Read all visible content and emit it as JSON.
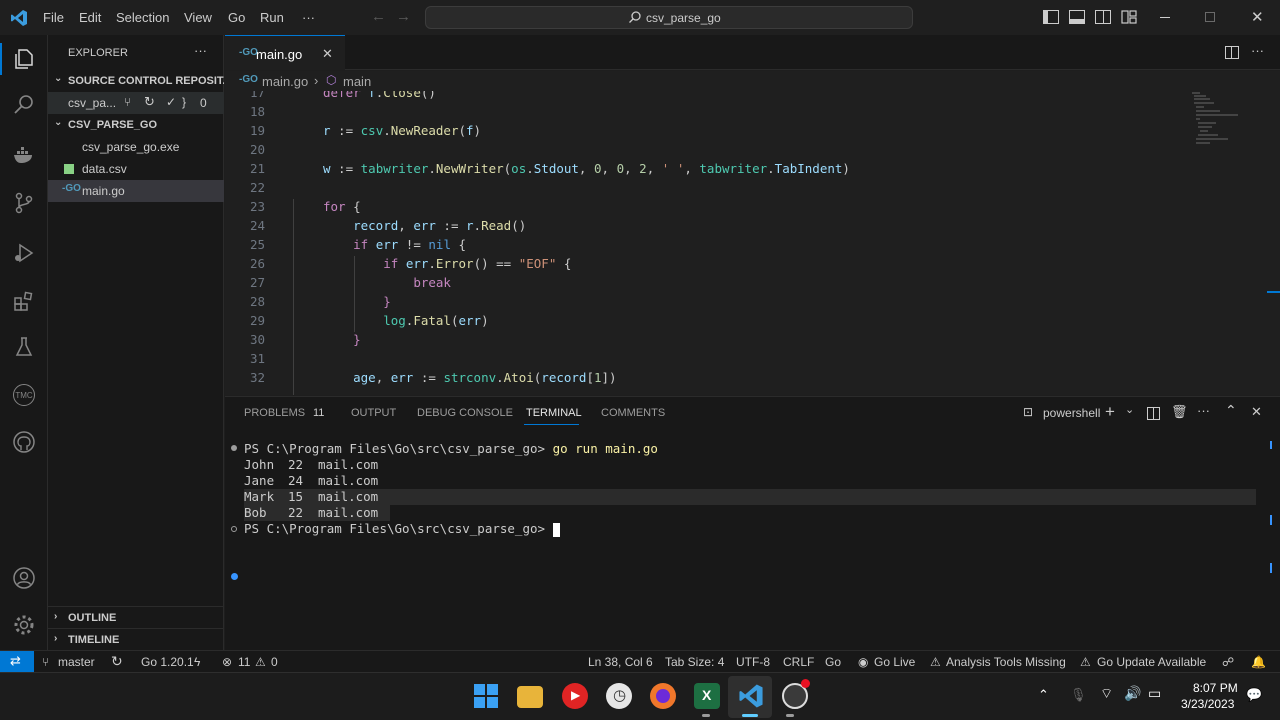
{
  "titlebar": {
    "menu": [
      "File",
      "Edit",
      "Selection",
      "View",
      "Go",
      "Run",
      "···"
    ],
    "command_center": "csv_parse_go"
  },
  "sidebar": {
    "title": "EXPLORER",
    "more": "···",
    "source_control": {
      "header": "SOURCE CONTROL REPOSIT...",
      "repo": "csv_pa...",
      "count": "0"
    },
    "folder": "CSV_PARSE_GO",
    "files": [
      "csv_parse_go.exe",
      "data.csv",
      "main.go"
    ],
    "outline": "OUTLINE",
    "timeline": "TIMELINE"
  },
  "editor": {
    "tab_label": "main.go",
    "breadcrumb_file": "main.go",
    "breadcrumb_symbol": "main",
    "line_numbers": [
      "17",
      "18",
      "19",
      "20",
      "21",
      "22",
      "23",
      "24",
      "25",
      "26",
      "27",
      "28",
      "29",
      "30",
      "31",
      "32"
    ]
  },
  "panel": {
    "tabs": [
      "PROBLEMS",
      "OUTPUT",
      "DEBUG CONSOLE",
      "TERMINAL",
      "COMMENTS"
    ],
    "problems_count": "11",
    "shell": "powershell",
    "terminal": {
      "prompt1": "PS C:\\Program Files\\Go\\src\\csv_parse_go> ",
      "command": "go run main.go",
      "rows": [
        [
          "John",
          "22",
          "mail.com"
        ],
        [
          "Jane",
          "24",
          "mail.com"
        ],
        [
          "Mark",
          "15",
          "mail.com"
        ],
        [
          "Bob",
          "22",
          "mail.com"
        ]
      ],
      "prompt2": "PS C:\\Program Files\\Go\\src\\csv_parse_go> "
    }
  },
  "statusbar": {
    "branch": "master",
    "go_version": "Go 1.20.1",
    "errors": "11",
    "warnings": "0",
    "position": "Ln 38, Col 6",
    "tab_size": "Tab Size: 4",
    "encoding": "UTF-8",
    "eol": "CRLF",
    "language": "Go",
    "go_live": "Go Live",
    "analysis": "Analysis Tools Missing",
    "go_update": "Go Update Available"
  },
  "taskbar": {
    "time": "8:07 PM",
    "date": "3/23/2023"
  },
  "colors": {
    "accent": "#0078d4",
    "go_icon": "#519aba",
    "csv_icon": "#89d185"
  }
}
